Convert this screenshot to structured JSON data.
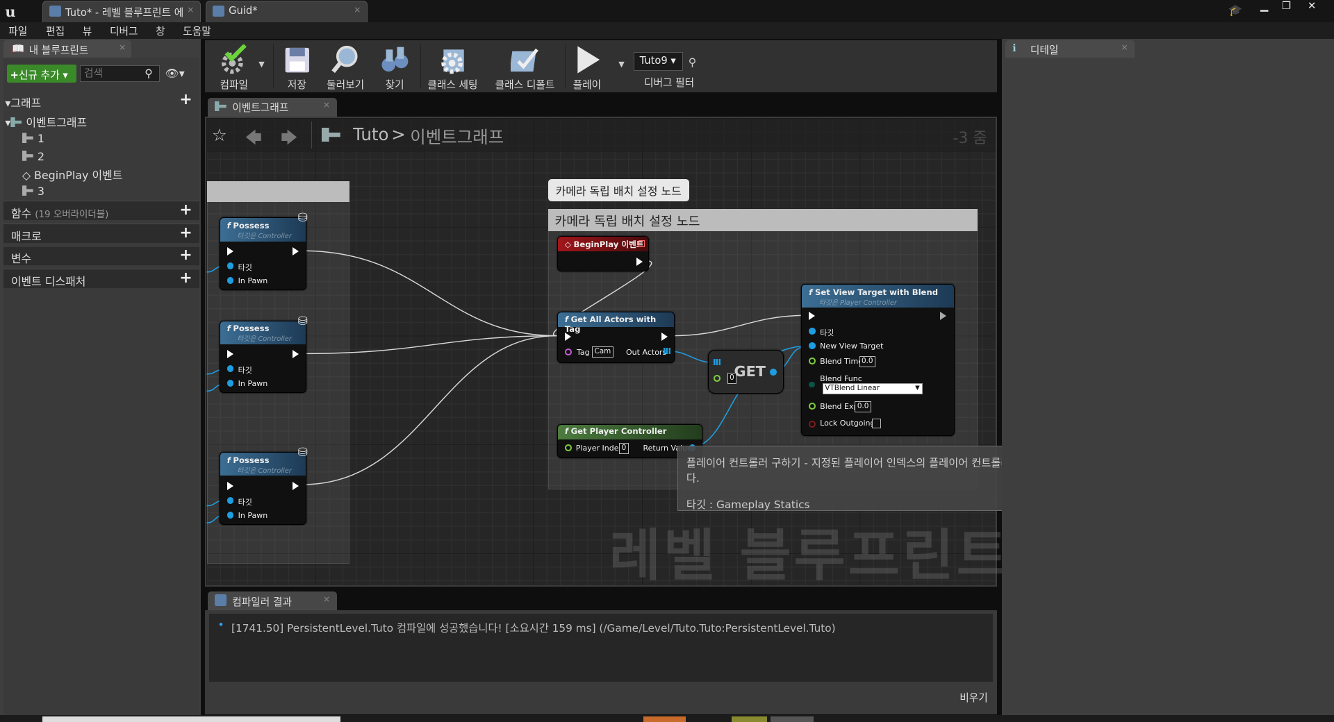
{
  "titlebar": {
    "tab1": "Tuto* - 레벨 블루프린트 에",
    "tab2": "Guid*"
  },
  "menu": [
    "파일",
    "편집",
    "뷰",
    "디버그",
    "창",
    "도움말"
  ],
  "left": {
    "tab": "내 블루프린트",
    "add_new": "신규 추가",
    "search_placeholder": "검색",
    "graph_section": "그래프",
    "event_graph": "이벤트그래프",
    "items": [
      "1",
      "2",
      "BeginPlay 이벤트",
      "3"
    ],
    "functions": "함수",
    "functions_override": "(19 오버라이더블)",
    "macros": "매크로",
    "variables": "변수",
    "dispatchers": "이벤트 디스패처"
  },
  "toolbar": {
    "compile": "컴파일",
    "save": "저장",
    "browse": "둘러보기",
    "find": "찾기",
    "class_settings": "클래스 세팅",
    "class_defaults": "클래스 디폴트",
    "play": "플레이",
    "debug_object": "Tuto9",
    "debug_filter": "디버그 필터"
  },
  "graph": {
    "tab": "이벤트그래프",
    "crumb_root": "Tuto",
    "crumb_sep": ">",
    "crumb_leaf": "이벤트그래프",
    "zoom": "-3 줌",
    "watermark": "레벨 블루프린트",
    "comment_bubble": "카메라 독립 배치 설정 노드",
    "comment_title": "카메라 독립 배치 설정 노드",
    "possess": {
      "title": "Possess",
      "target": "타깃은 Controller",
      "pin_target": "타깃",
      "pin_pawn": "In Pawn"
    },
    "beginplay": "BeginPlay 이벤트",
    "get_all": {
      "title": "Get All Actors with Tag",
      "tag": "Tag",
      "tag_value": "Cam",
      "out": "Out Actors"
    },
    "get": {
      "title": "GET",
      "index": "0"
    },
    "gpc": {
      "title": "Get Player Controller",
      "index_label": "Player Index",
      "index": "0",
      "ret": "Return Value"
    },
    "svt": {
      "title": "Set View Target with Blend",
      "target_sub": "타깃은 Player Controller",
      "target": "타깃",
      "new_view": "New View Target",
      "blend_time": "Blend Time",
      "blend_time_val": "0.0",
      "blend_func": "Blend Func",
      "blend_func_val": "VTBlend Linear",
      "blend_exp": "Blend Exp",
      "blend_exp_val": "0.0",
      "lock": "Lock Outgoing"
    },
    "tooltip_line1": "플레이어 컨트롤러 구하기 - 지정된 플레이어 인덱스의 플레이어 컨트롤러를 반환합니다.",
    "tooltip_line2": "타깃 : Gameplay Statics"
  },
  "output": {
    "tab": "컴파일러 결과",
    "log": "[1741.50] PersistentLevel.Tuto 컴파일에 성공했습니다! [소요시간 159 ms] (/Game/Level/Tuto.Tuto:PersistentLevel.Tuto)",
    "clear": "비우기"
  },
  "details": {
    "tab": "디테일"
  }
}
